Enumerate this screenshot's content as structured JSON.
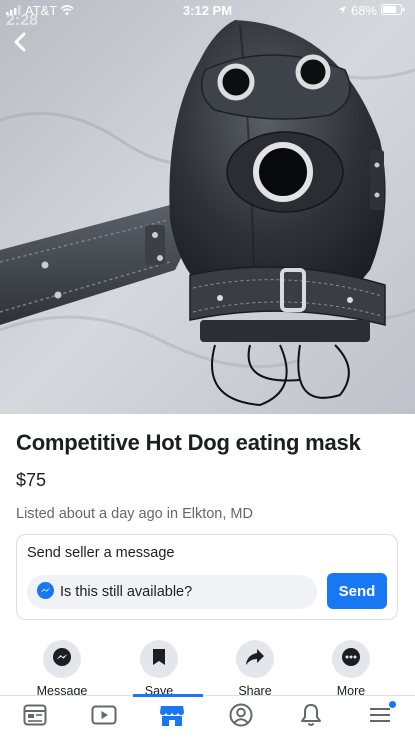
{
  "status_bar": {
    "carrier": "AT&T",
    "time": "3:12 PM",
    "battery": "68%",
    "ghost_time": "2:28"
  },
  "listing": {
    "title": "Competitive Hot Dog eating mask",
    "price": "$75",
    "listed": "Listed about a day ago in Elkton, MD"
  },
  "message": {
    "heading": "Send seller a message",
    "input_value": "Is this still available?",
    "send_label": "Send"
  },
  "actions": [
    {
      "label": "Message",
      "icon": "messenger-icon"
    },
    {
      "label": "Save",
      "icon": "bookmark-icon"
    },
    {
      "label": "Share",
      "icon": "share-icon"
    },
    {
      "label": "More",
      "icon": "more-icon"
    }
  ],
  "tabs": [
    {
      "name": "news-feed",
      "icon": "news-feed-icon"
    },
    {
      "name": "watch",
      "icon": "video-icon"
    },
    {
      "name": "marketplace",
      "icon": "marketplace-icon",
      "active": true
    },
    {
      "name": "profile",
      "icon": "profile-icon"
    },
    {
      "name": "notifications",
      "icon": "bell-icon"
    },
    {
      "name": "menu",
      "icon": "menu-icon"
    }
  ],
  "colors": {
    "accent": "#1877f2",
    "text": "#1c1e21",
    "secondary_text": "#65676b"
  }
}
